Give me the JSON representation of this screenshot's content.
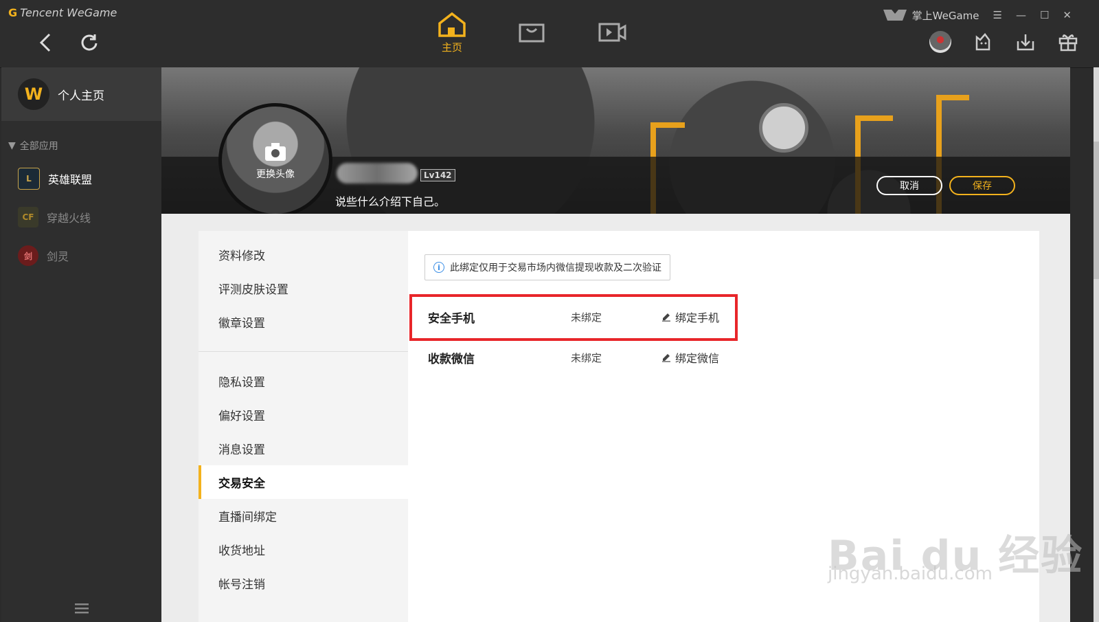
{
  "titlebar": {
    "brand": "Tencent WeGame",
    "mobile_label": "掌上WeGame"
  },
  "topnav": {
    "home_label": "主页",
    "accent_color": "#f3b21d"
  },
  "sidebar": {
    "profile_label": "个人主页",
    "section_title": "全部应用",
    "apps": [
      {
        "label": "英雄联盟",
        "active": true
      },
      {
        "label": "穿越火线",
        "active": false
      },
      {
        "label": "剑灵",
        "active": false
      }
    ]
  },
  "profile": {
    "change_avatar": "更换头像",
    "level": "Lv142",
    "bio_placeholder": "说些什么介绍下自己。",
    "cancel_label": "取消",
    "save_label": "保存"
  },
  "settings_menu": {
    "group1": [
      "资料修改",
      "评测皮肤设置",
      "徽章设置"
    ],
    "group2": [
      "隐私设置",
      "偏好设置",
      "消息设置",
      "交易安全",
      "直播间绑定",
      "收货地址",
      "帐号注销"
    ],
    "active": "交易安全"
  },
  "panel": {
    "notice": "此绑定仅用于交易市场内微信提现收款及二次验证",
    "rows": [
      {
        "label": "安全手机",
        "status": "未绑定",
        "action": "绑定手机"
      },
      {
        "label": "收款微信",
        "status": "未绑定",
        "action": "绑定微信"
      }
    ]
  },
  "watermark": {
    "main": "Bai du 经验",
    "sub": "jingyan.baidu.com"
  }
}
